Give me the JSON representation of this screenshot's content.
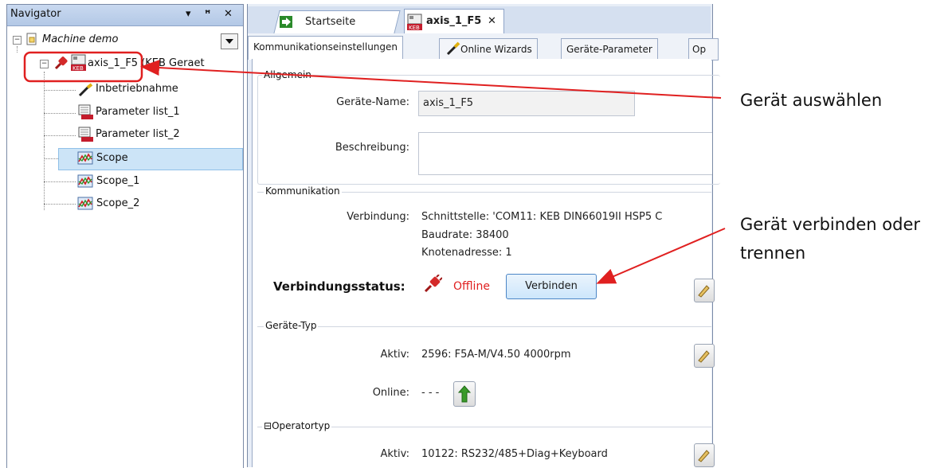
{
  "navigator": {
    "title": "Navigator",
    "ctrl_dropdown": "▾",
    "ctrl_pin": "ᵖ",
    "ctrl_close": "✕",
    "root": "Machine demo",
    "device": "axis_1_F5 (KEB Geraet",
    "items": [
      "Inbetriebnahme",
      "Parameter list_1",
      "Parameter list_2",
      "Scope",
      "Scope_1",
      "Scope_2"
    ],
    "selected_item": "Scope"
  },
  "doc_tabs": [
    {
      "label": "Startseite"
    },
    {
      "label": "axis_1_F5",
      "close": "✕"
    }
  ],
  "sub_tabs": [
    "Kommunikationseinstellungen",
    "Online Wizards",
    "Geräte-Parameter",
    "Op"
  ],
  "allgemein": {
    "title": "Allgemein",
    "name_label": "Geräte-Name:",
    "name_value": "axis_1_F5",
    "desc_label": "Beschreibung:"
  },
  "kommunikation": {
    "title": "Kommunikation",
    "conn_label": "Verbindung:",
    "conn_lines": [
      "Schnittstelle: 'COM11: KEB DIN66019II HSP5 C",
      "Baudrate: 38400",
      "Knotenadresse: 1"
    ],
    "status_label": "Verbindungsstatus:",
    "status_value": "Offline",
    "connect_button": "Verbinden",
    "status_color": "#e02020"
  },
  "geraete_typ": {
    "title": "Geräte-Typ",
    "aktiv_label": "Aktiv:",
    "aktiv_value": "2596: F5A-M/V4.50 4000rpm",
    "online_label": "Online:",
    "online_value": "- - -"
  },
  "operatortyp": {
    "title": "Operatortyp",
    "collapse": "⊟",
    "aktiv_label": "Aktiv:",
    "aktiv_value": "10122: RS232/485+Diag+Keyboard"
  },
  "annotations": {
    "select_device": "Gerät auswählen",
    "connect_device_line1": "Gerät verbinden oder",
    "connect_device_line2": "trennen",
    "color": "#e02020"
  }
}
